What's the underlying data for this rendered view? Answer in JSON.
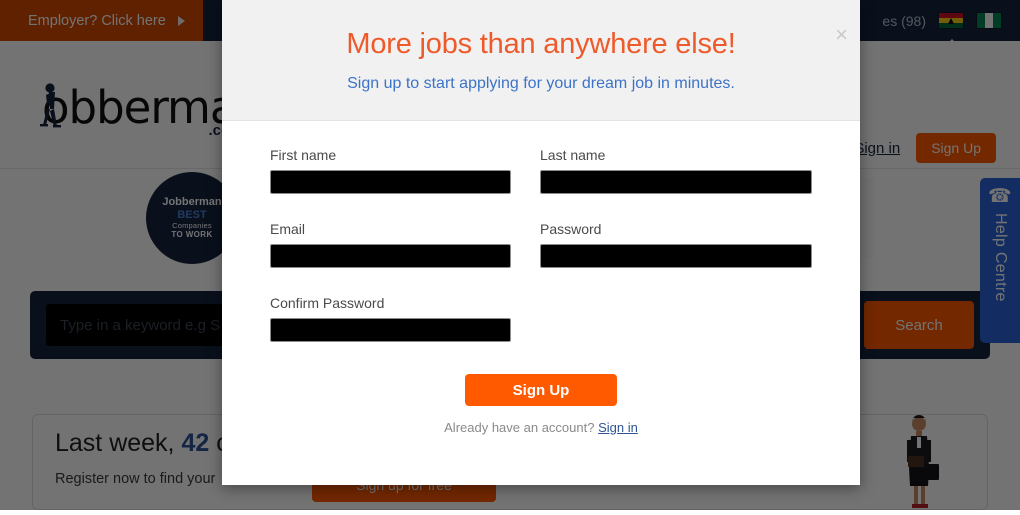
{
  "topbar": {
    "employer_label": "Employer? Click here",
    "employer_caret_icon": "triangle-right-icon",
    "truncated_link": "es (98)",
    "flag_gh_icon": "ghana-flag-icon",
    "flag_ng_icon": "nigeria-flag-icon"
  },
  "header": {
    "logo_word": "obberman",
    "logo_tld": ".com.gh",
    "signin_label": "Sign in",
    "signup_label": "Sign Up"
  },
  "badge": {
    "brand": "Jobberman",
    "best": "BEST",
    "sub": "Companies",
    "work": "TO WORK"
  },
  "search": {
    "placeholder": "Type in a keyword e.g S",
    "value": "",
    "button_label": "Search"
  },
  "promo": {
    "head_prefix": "Last week, ",
    "count": "42",
    "head_suffix": " co",
    "sub": "Register now to find your",
    "cta_label": "Sign up for free"
  },
  "help": {
    "phone_icon": "phone-icon",
    "label": "Help Centre"
  },
  "modal": {
    "title": "More jobs than anywhere else!",
    "subtitle": "Sign up to start applying for your dream job in minutes.",
    "close_icon": "close-icon",
    "close_label": "×",
    "fields": [
      {
        "label": "First name",
        "value": "",
        "placeholder": ""
      },
      {
        "label": "Last name",
        "value": "",
        "placeholder": ""
      },
      {
        "label": "Email",
        "value": "",
        "placeholder": ""
      },
      {
        "label": "Password",
        "value": "",
        "placeholder": ""
      },
      {
        "label": "Confirm Password",
        "value": "",
        "placeholder": ""
      }
    ],
    "submit_label": "Sign Up",
    "footer_prompt": "Already have an account?",
    "footer_link": "Sign in"
  },
  "colors": {
    "accent_orange": "#ff5a00",
    "title_orange": "#ef5a2a",
    "navy": "#16243f",
    "link_blue": "#3c73c8",
    "help_blue": "#2b63d9",
    "employer_red": "#d24900"
  }
}
